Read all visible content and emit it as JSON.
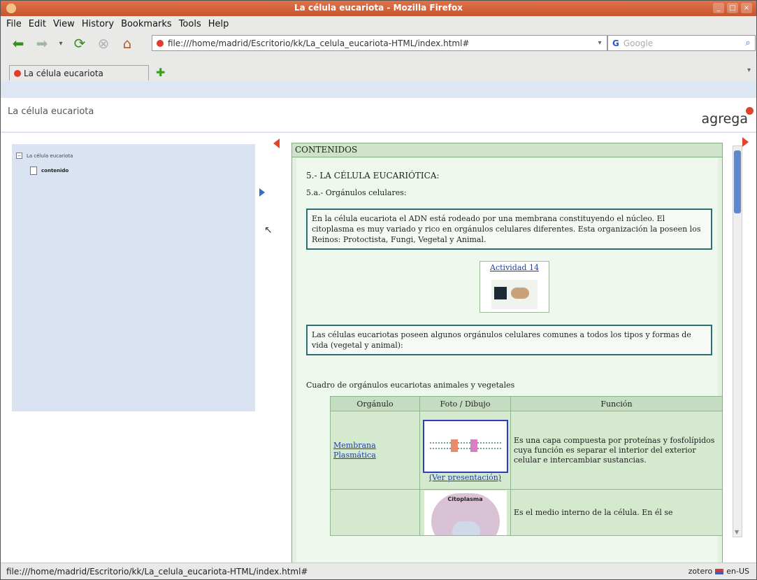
{
  "window": {
    "title": "La célula eucariota - Mozilla Firefox",
    "buttons": [
      "_",
      "□",
      "×"
    ]
  },
  "menu": [
    "File",
    "Edit",
    "View",
    "History",
    "Bookmarks",
    "Tools",
    "Help"
  ],
  "navbar": {
    "back_icon": "back-arrow-icon",
    "forward_icon": "forward-arrow-icon",
    "reload_icon": "reload-icon",
    "stop_icon": "stop-icon",
    "home_icon": "home-icon",
    "url": "file:///home/madrid/Escritorio/kk/La_celula_eucariota-HTML/index.html#",
    "search_engine": "G",
    "search_placeholder": "Google"
  },
  "tabs": [
    {
      "label": "La célula eucariota"
    }
  ],
  "page": {
    "header_title": "La célula eucariota",
    "logo": "agrega",
    "tree": {
      "root": "La célula eucariota",
      "child": "contenido"
    },
    "panel_header": "CONTENIDOS",
    "section_title": "5.- LA CÉLULA EUCARIÓTICA:",
    "subsection": "5.a.- Orgánulos celulares:",
    "box1": "En la célula eucariota el ADN está rodeado por una membrana constituyendo el núcleo. El citoplasma es muy variado y rico en orgánulos celulares diferentes. Esta organización la poseen los Reinos: Protoctista, Fungi, Vegetal y Animal.",
    "activity_link": "Actividad 14",
    "box2": "Las células eucariotas poseen algunos orgánulos celulares comunes a todos los tipos y formas de vida (vegetal y animal):",
    "table_caption": "Cuadro de orgánulos eucariotas animales y vegetales",
    "table": {
      "headers": [
        "Orgánulo",
        "Foto / Dibujo",
        "Función"
      ],
      "rows": [
        {
          "organelle": "Membrana Plasmática",
          "photo_link": "(Ver presentación)",
          "function": "Es una capa compuesta por proteínas y fosfolípidos cuya función es separar el interior del exterior celular e intercambiar sustancias."
        },
        {
          "organelle": "",
          "photo_label": "Citoplasma",
          "function": "Es el medio interno de la célula. En él se"
        }
      ]
    }
  },
  "status": {
    "text": "file:///home/madrid/Escritorio/kk/La_celula_eucariota-HTML/index.html#",
    "right_zotero": "zotero",
    "right_locale": "en-US"
  }
}
